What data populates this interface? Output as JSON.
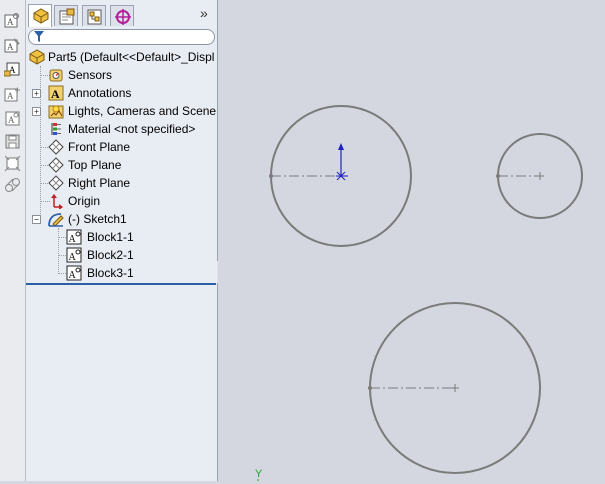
{
  "left_toolbar": {
    "icons": [
      "insert-block-icon",
      "edit-block-icon",
      "make-block-icon",
      "add-remove-block-icon",
      "rebuild-block-icon",
      "save-block-icon",
      "explode-block-icon",
      "belt-chain-icon"
    ]
  },
  "feature_manager": {
    "tabs": [
      {
        "name": "featuremanager-tree-icon",
        "active": true
      },
      {
        "name": "propertymanager-icon",
        "active": false
      },
      {
        "name": "configurationmanager-icon",
        "active": false
      },
      {
        "name": "dimxpertmanager-icon",
        "active": false
      }
    ],
    "chevron": "»",
    "filter_icon": "filter-icon",
    "tree": {
      "root": "Part5  (Default<<Default>_Displ",
      "items": [
        {
          "label": "Sensors",
          "icon": "sensors-icon",
          "expandable": false
        },
        {
          "label": "Annotations",
          "icon": "annotations-icon",
          "expandable": true
        },
        {
          "label": "Lights, Cameras and Scene",
          "icon": "lights-icon",
          "expandable": true
        },
        {
          "label": "Material <not specified>",
          "icon": "material-icon",
          "expandable": false
        },
        {
          "label": "Front Plane",
          "icon": "plane-icon",
          "expandable": false
        },
        {
          "label": "Top Plane",
          "icon": "plane-icon",
          "expandable": false
        },
        {
          "label": "Right Plane",
          "icon": "plane-icon",
          "expandable": false
        },
        {
          "label": "Origin",
          "icon": "origin-icon",
          "expandable": false
        },
        {
          "label": "(-) Sketch1",
          "icon": "sketch-icon",
          "expandable": true,
          "expanded": true
        }
      ],
      "sketch_children": [
        {
          "label": "Block1-1"
        },
        {
          "label": "Block2-1"
        },
        {
          "label": "Block3-1"
        }
      ]
    }
  },
  "canvas": {
    "axis_label": "Y",
    "colors": {
      "background": "#d4d7e0",
      "circle": "#7b7b7b",
      "origin": "#2020c0"
    }
  }
}
